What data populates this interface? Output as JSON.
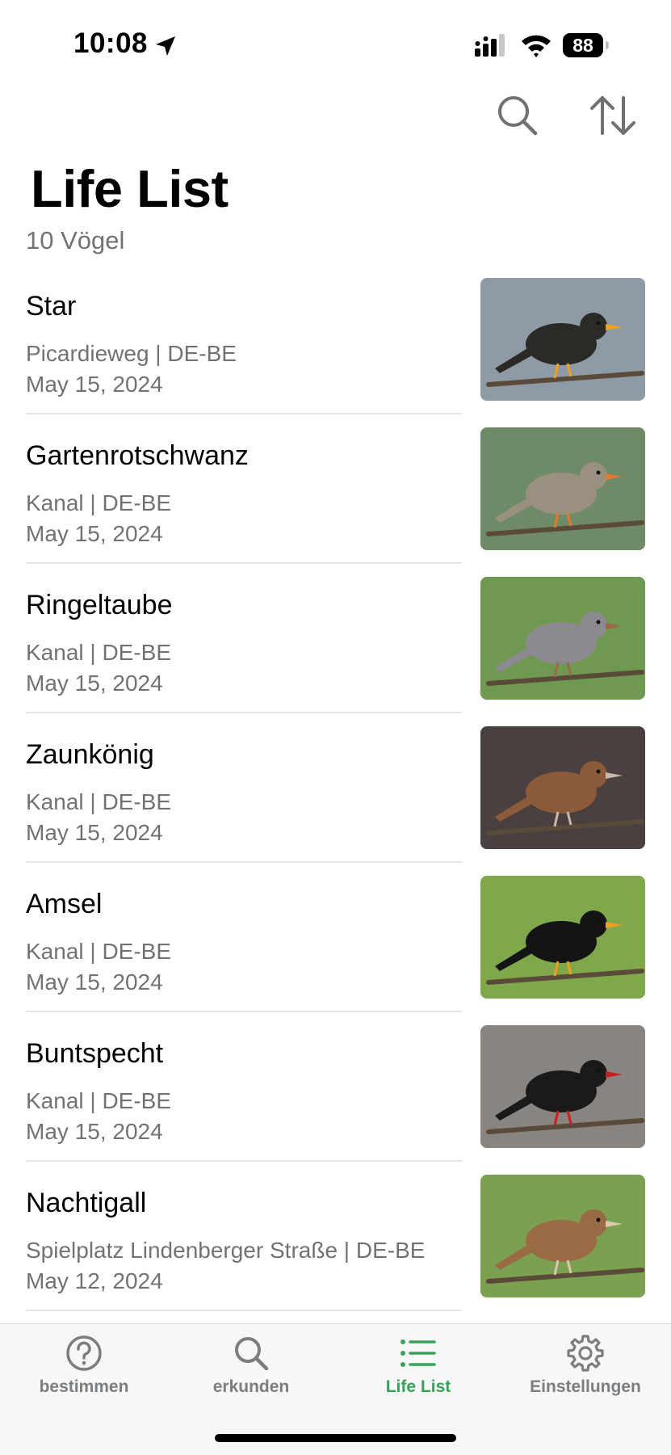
{
  "status_bar": {
    "time": "10:08",
    "battery": "88"
  },
  "header": {
    "title": "Life List",
    "subtitle": "10 Vögel"
  },
  "icons": {
    "search": "search-icon",
    "sort": "sort-icon"
  },
  "birds": [
    {
      "name": "Star",
      "location": "Picardieweg | DE-BE",
      "date": "May 15, 2024",
      "bg": "#8e9aa6",
      "body": "#2c2a27",
      "accent": "#f0a020"
    },
    {
      "name": "Gartenrotschwanz",
      "location": "Kanal | DE-BE",
      "date": "May 15, 2024",
      "bg": "#6f8a66",
      "body": "#9a9080",
      "accent": "#e07a2e"
    },
    {
      "name": "Ringeltaube",
      "location": "Kanal | DE-BE",
      "date": "May 15, 2024",
      "bg": "#6f9950",
      "body": "#8c8a90",
      "accent": "#9a6a4a"
    },
    {
      "name": "Zaunkönig",
      "location": "Kanal | DE-BE",
      "date": "May 15, 2024",
      "bg": "#4a4040",
      "body": "#8a5a3a",
      "accent": "#c8b9a8"
    },
    {
      "name": "Amsel",
      "location": "Kanal | DE-BE",
      "date": "May 15, 2024",
      "bg": "#7fa84a",
      "body": "#141414",
      "accent": "#f0a020"
    },
    {
      "name": "Buntspecht",
      "location": "Kanal | DE-BE",
      "date": "May 15, 2024",
      "bg": "#8a8480",
      "body": "#1a1a1a",
      "accent": "#c82020"
    },
    {
      "name": "Nachtigall",
      "location": "Spielplatz Lindenberger Straße | DE-BE",
      "date": "May 12, 2024",
      "bg": "#7aa050",
      "body": "#9a6a44",
      "accent": "#d8c8b0"
    }
  ],
  "tabs": [
    {
      "label": "bestimmen",
      "icon": "question-circle-icon",
      "active": false
    },
    {
      "label": "erkunden",
      "icon": "search-icon",
      "active": false
    },
    {
      "label": "Life List",
      "icon": "list-icon",
      "active": true
    },
    {
      "label": "Einstellungen",
      "icon": "gear-icon",
      "active": false
    }
  ],
  "colors": {
    "accent": "#3aa05a",
    "secondary_text": "#6f7376",
    "tab_inactive": "#7a7e81"
  }
}
